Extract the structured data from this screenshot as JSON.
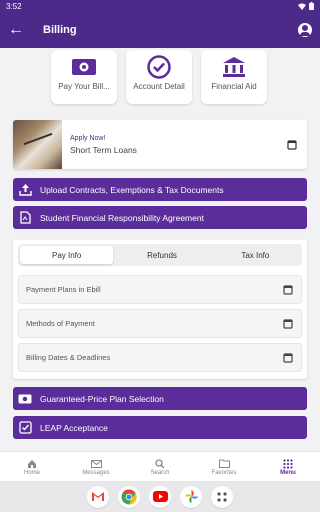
{
  "status": {
    "time": "3:52"
  },
  "header": {
    "title": "Billing"
  },
  "tiles": [
    {
      "label": "Pay Your Bill...",
      "icon": "money-icon"
    },
    {
      "label": "Account Detail",
      "icon": "check-circle-icon"
    },
    {
      "label": "Financial Aid",
      "icon": "bank-icon"
    }
  ],
  "loan": {
    "apply": "Apply Now!",
    "name": "Short Term Loans"
  },
  "buttons": {
    "upload": "Upload Contracts, Exemptions & Tax Documents",
    "agreement": "Student Financial Responsibility Agreement",
    "guaranteed": "Guaranteed-Price Plan Selection",
    "leap": "LEAP Acceptance"
  },
  "pay_tabs": [
    "Pay Info",
    "Refunds",
    "Tax Info"
  ],
  "pay_rows": [
    "Payment Plans in Ebill",
    "Methods of Payment",
    "Billing Dates & Deadlines"
  ],
  "nav": [
    "Home",
    "Messages",
    "Search",
    "Favorites",
    "Menu"
  ],
  "colors": {
    "brand": "#4b2a8a",
    "button": "#5b2d9a"
  }
}
